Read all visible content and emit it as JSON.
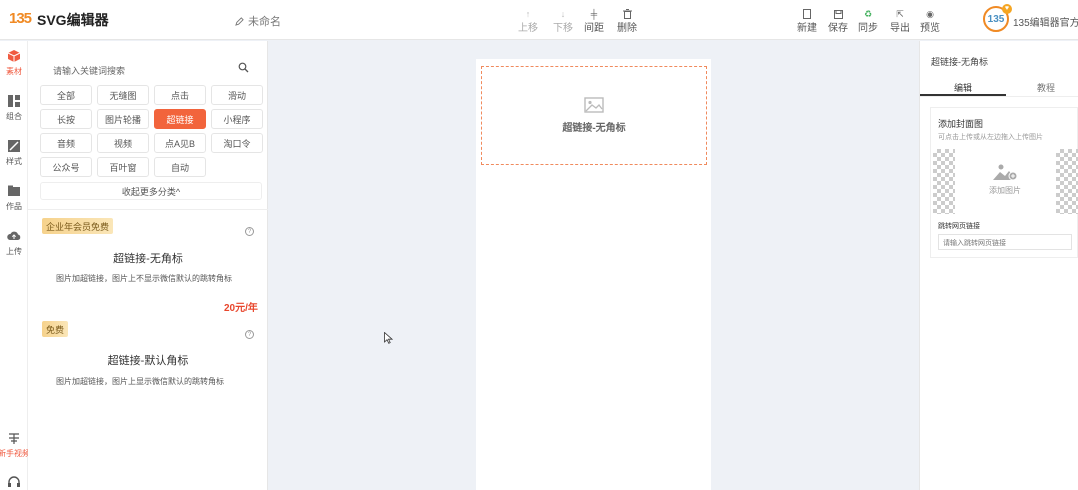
{
  "header": {
    "logo_text": "135",
    "app_title": "SVG编辑器",
    "doc_name": "未命名",
    "center_tools": [
      {
        "label": "上移",
        "icon": "arrow-up-icon",
        "disabled": true
      },
      {
        "label": "下移",
        "icon": "arrow-down-icon",
        "disabled": true
      },
      {
        "label": "间距",
        "icon": "spacing-icon",
        "disabled": false
      },
      {
        "label": "删除",
        "icon": "trash-icon",
        "disabled": false
      }
    ],
    "right_tools": [
      {
        "label": "新建",
        "icon": "new-file-icon"
      },
      {
        "label": "保存",
        "icon": "save-icon"
      },
      {
        "label": "同步",
        "icon": "sync-icon"
      },
      {
        "label": "导出",
        "icon": "export-icon"
      },
      {
        "label": "预览",
        "icon": "eye-icon"
      }
    ],
    "user_name": "135编辑器官方",
    "avatar_text": "135"
  },
  "rail": {
    "items": [
      {
        "label": "素材",
        "icon": "cube-icon",
        "active": true
      },
      {
        "label": "组合",
        "icon": "grid-icon",
        "active": false
      },
      {
        "label": "样式",
        "icon": "style-icon",
        "active": false
      },
      {
        "label": "作品",
        "icon": "folder-icon",
        "active": false
      },
      {
        "label": "上传",
        "icon": "cloud-upload-icon",
        "active": false
      }
    ],
    "bottom_items": [
      {
        "label": "新手视频",
        "icon": "video-icon"
      },
      {
        "label": "",
        "icon": "headset-icon"
      }
    ]
  },
  "panel": {
    "search_placeholder": "请输入关键词搜索",
    "categories": [
      "全部",
      "无缝图",
      "点击",
      "滑动",
      "长按",
      "图片轮播",
      "超链接",
      "小程序",
      "音频",
      "视频",
      "点A见B",
      "淘口令",
      "公众号",
      "百叶窗",
      "自动"
    ],
    "active_category": "超链接",
    "more_label": "收起更多分类^",
    "cards": [
      {
        "badge": "企业年会员免费",
        "title": "超链接-无角标",
        "desc": "图片加超链接，图片上不显示微信默认的跳转角标",
        "price": "20元/年"
      },
      {
        "badge": "免费",
        "title": "超链接-默认角标",
        "desc": "图片加超链接，图片上显示微信默认的跳转角标",
        "price": ""
      }
    ]
  },
  "canvas": {
    "selected_title": "超链接-无角标"
  },
  "right_panel": {
    "title": "超链接-无角标",
    "tabs": [
      "编辑",
      "教程"
    ],
    "active_tab": "编辑",
    "cover_title": "添加封面图",
    "cover_hint": "可点击上传或从左边拖入上传图片",
    "add_image_label": "添加图片",
    "link_label": "跳转网页链接",
    "link_placeholder": "请输入跳转网页链接"
  },
  "colors": {
    "accent": "#f2643c",
    "badge_gold": "#f6d28c",
    "price_red": "#e8462c",
    "selection_border": "#f08a5d"
  }
}
